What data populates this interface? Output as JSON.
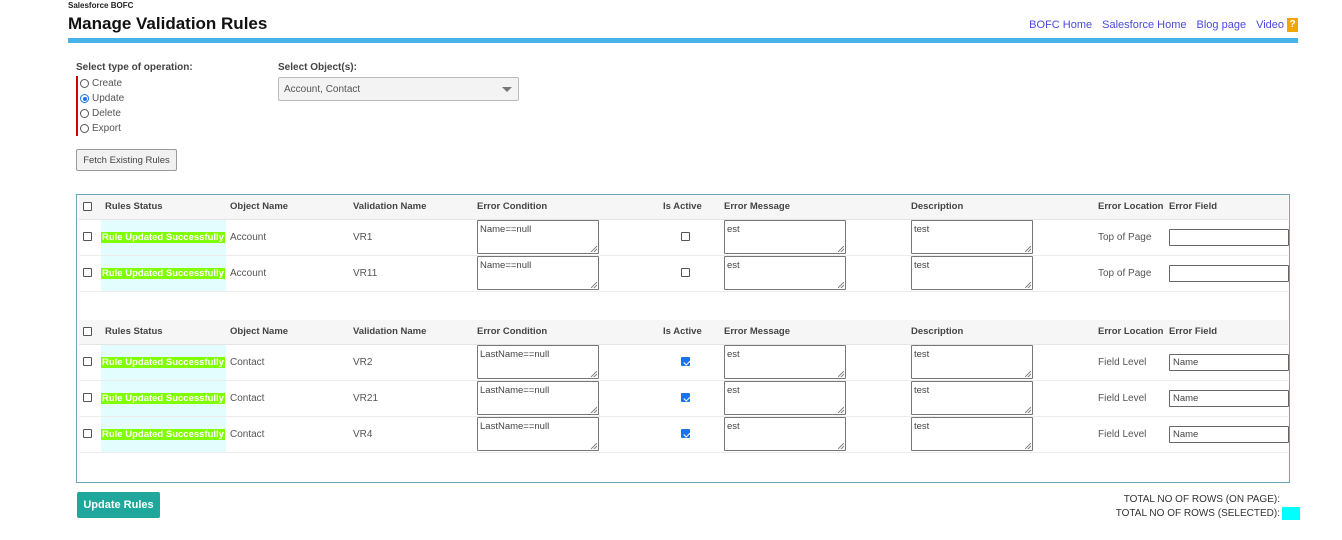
{
  "header": {
    "app_name": "Salesforce BOFC",
    "title": "Manage Validation Rules",
    "links": [
      "BOFC Home",
      "Salesforce Home",
      "Blog page",
      "Video"
    ],
    "help_icon": "?"
  },
  "operation": {
    "label": "Select type of operation:",
    "options": [
      "Create",
      "Update",
      "Delete",
      "Export"
    ],
    "selected": "Update"
  },
  "objects": {
    "label": "Select Object(s):",
    "value": "Account, Contact"
  },
  "fetch_button": "Fetch Existing Rules",
  "columns": [
    "Rules Status",
    "Object Name",
    "Validation Name",
    "Error Condition",
    "Is Active",
    "Error Message",
    "Description",
    "Error Location",
    "Error Field"
  ],
  "groups": [
    {
      "rows": [
        {
          "status": "Rule Updated Successfully",
          "object": "Account",
          "name": "VR1",
          "condition": "Name==null",
          "active": false,
          "message": "est",
          "description": "test",
          "location": "Top of Page",
          "field": ""
        },
        {
          "status": "Rule Updated Successfully",
          "object": "Account",
          "name": "VR11",
          "condition": "Name==null",
          "active": false,
          "message": "est",
          "description": "test",
          "location": "Top of Page",
          "field": ""
        }
      ]
    },
    {
      "rows": [
        {
          "status": "Rule Updated Successfully",
          "object": "Contact",
          "name": "VR2",
          "condition": "LastName==null",
          "active": true,
          "message": "est",
          "description": "test",
          "location": "Field Level",
          "field": "Name"
        },
        {
          "status": "Rule Updated Successfully",
          "object": "Contact",
          "name": "VR21",
          "condition": "LastName==null",
          "active": true,
          "message": "est",
          "description": "test",
          "location": "Field Level",
          "field": "Name"
        },
        {
          "status": "Rule Updated Successfully",
          "object": "Contact",
          "name": "VR4",
          "condition": "LastName==null",
          "active": true,
          "message": "est",
          "description": "test",
          "location": "Field Level",
          "field": "Name"
        }
      ]
    }
  ],
  "update_button": "Update Rules",
  "totals": {
    "on_page_label": "TOTAL NO OF ROWS (ON PAGE):",
    "selected_label": "TOTAL NO OF ROWS (SELECTED):"
  },
  "colors": {
    "accent_bar": "#47b3e8",
    "status_highlight": "#7fff00",
    "status_cell_bg": "#e3fdfe",
    "update_button": "#1ea79a",
    "selected_count_box": "#00ffff",
    "required_marker": "#d40000"
  }
}
